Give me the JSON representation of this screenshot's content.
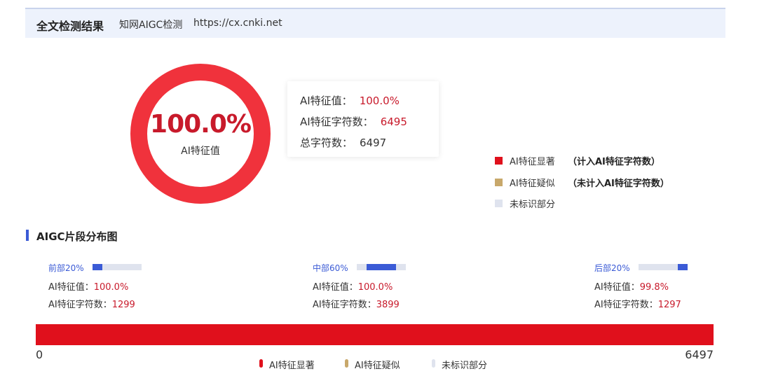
{
  "header": {
    "title": "全文检测结果",
    "subtitle": "知网AIGC检测",
    "url": "https://cx.cnki.net"
  },
  "colors": {
    "significant": "#e0101c",
    "suspected": "#c8a86b",
    "unmarked": "#dfe3ee",
    "accent": "#3b5bd6",
    "value_red": "#c81a2b"
  },
  "ring": {
    "percent_text": "100.0%",
    "percent_value": 1.0,
    "label": "AI特征值"
  },
  "summary": {
    "ai_value_label": "AI特征值：",
    "ai_value": "100.0%",
    "ai_chars_label": "AI特征字符数：",
    "ai_chars": "6495",
    "total_chars_label": "总字符数：",
    "total_chars": "6497"
  },
  "legend": {
    "significant": "AI特征显著",
    "significant_note": "（计入AI特征字符数）",
    "suspected": "AI特征疑似",
    "suspected_note": "（未计入AI特征字符数）",
    "unmarked": "未标识部分"
  },
  "distribution": {
    "title": "AIGC片段分布图",
    "value_label": "AI特征值：",
    "chars_label": "AI特征字符数：",
    "segments": [
      {
        "title": "前部20%",
        "ai_value": "100.0%",
        "ai_chars": "1299",
        "range": [
          0,
          0.2
        ]
      },
      {
        "title": "中部60%",
        "ai_value": "100.0%",
        "ai_chars": "3899",
        "range": [
          0.2,
          0.8
        ]
      },
      {
        "title": "后部20%",
        "ai_value": "99.8%",
        "ai_chars": "1297",
        "range": [
          0.8,
          1.0
        ]
      }
    ]
  },
  "chart_data": {
    "type": "bar",
    "title": "AIGC片段分布图",
    "x_min": "0",
    "x_max": "6497",
    "xlim": [
      0,
      6497
    ],
    "series": [
      {
        "name": "AI特征显著",
        "values": [
          [
            0,
            6497
          ]
        ]
      }
    ]
  }
}
